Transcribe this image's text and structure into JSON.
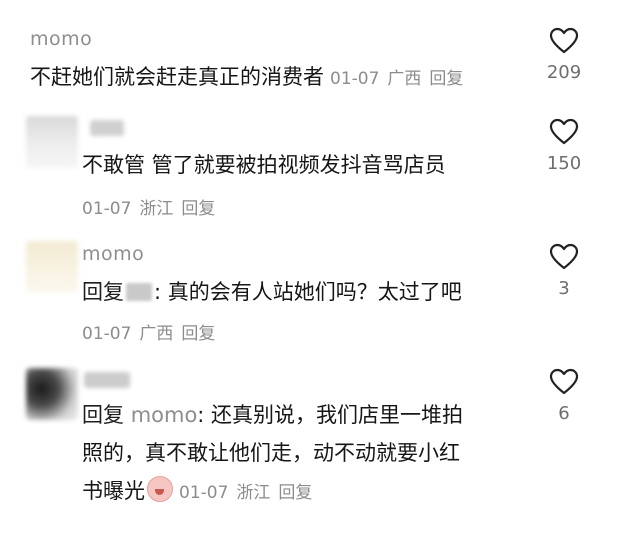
{
  "comments": [
    {
      "username": "momo",
      "text": "不赶她们就会赶走真正的消费者",
      "date": "01-07",
      "location": "广西",
      "reply_label": "回复",
      "likes": "209",
      "like_icon": "heart-outline-icon"
    },
    {
      "username": "",
      "text": "不敢管 管了就要被拍视频发抖音骂店员",
      "date": "01-07",
      "location": "浙江",
      "reply_label": "回复",
      "likes": "150",
      "like_icon": "heart-outline-icon"
    },
    {
      "username": "momo",
      "reply_prefix": "回复",
      "text": ": 真的会有人站她们吗？太过了吧",
      "date": "01-07",
      "location": "广西",
      "reply_label": "回复",
      "likes": "3",
      "like_icon": "heart-outline-icon"
    },
    {
      "username": "",
      "reply_prefix": "回复",
      "reply_target": "momo",
      "text_line1": ": 还真别说，我们店里一堆拍",
      "text_line2": "照的，真不敢让他们走，动不动就要小红",
      "text_line3": "书曝光",
      "emoji": "crying-face-emoji",
      "date": "01-07",
      "location": "浙江",
      "reply_label": "回复",
      "likes": "6",
      "like_icon": "heart-outline-icon"
    }
  ],
  "colors": {
    "text": "#161616",
    "meta": "#8c8c8c",
    "username": "#8e8e8e",
    "background": "#ffffff"
  }
}
